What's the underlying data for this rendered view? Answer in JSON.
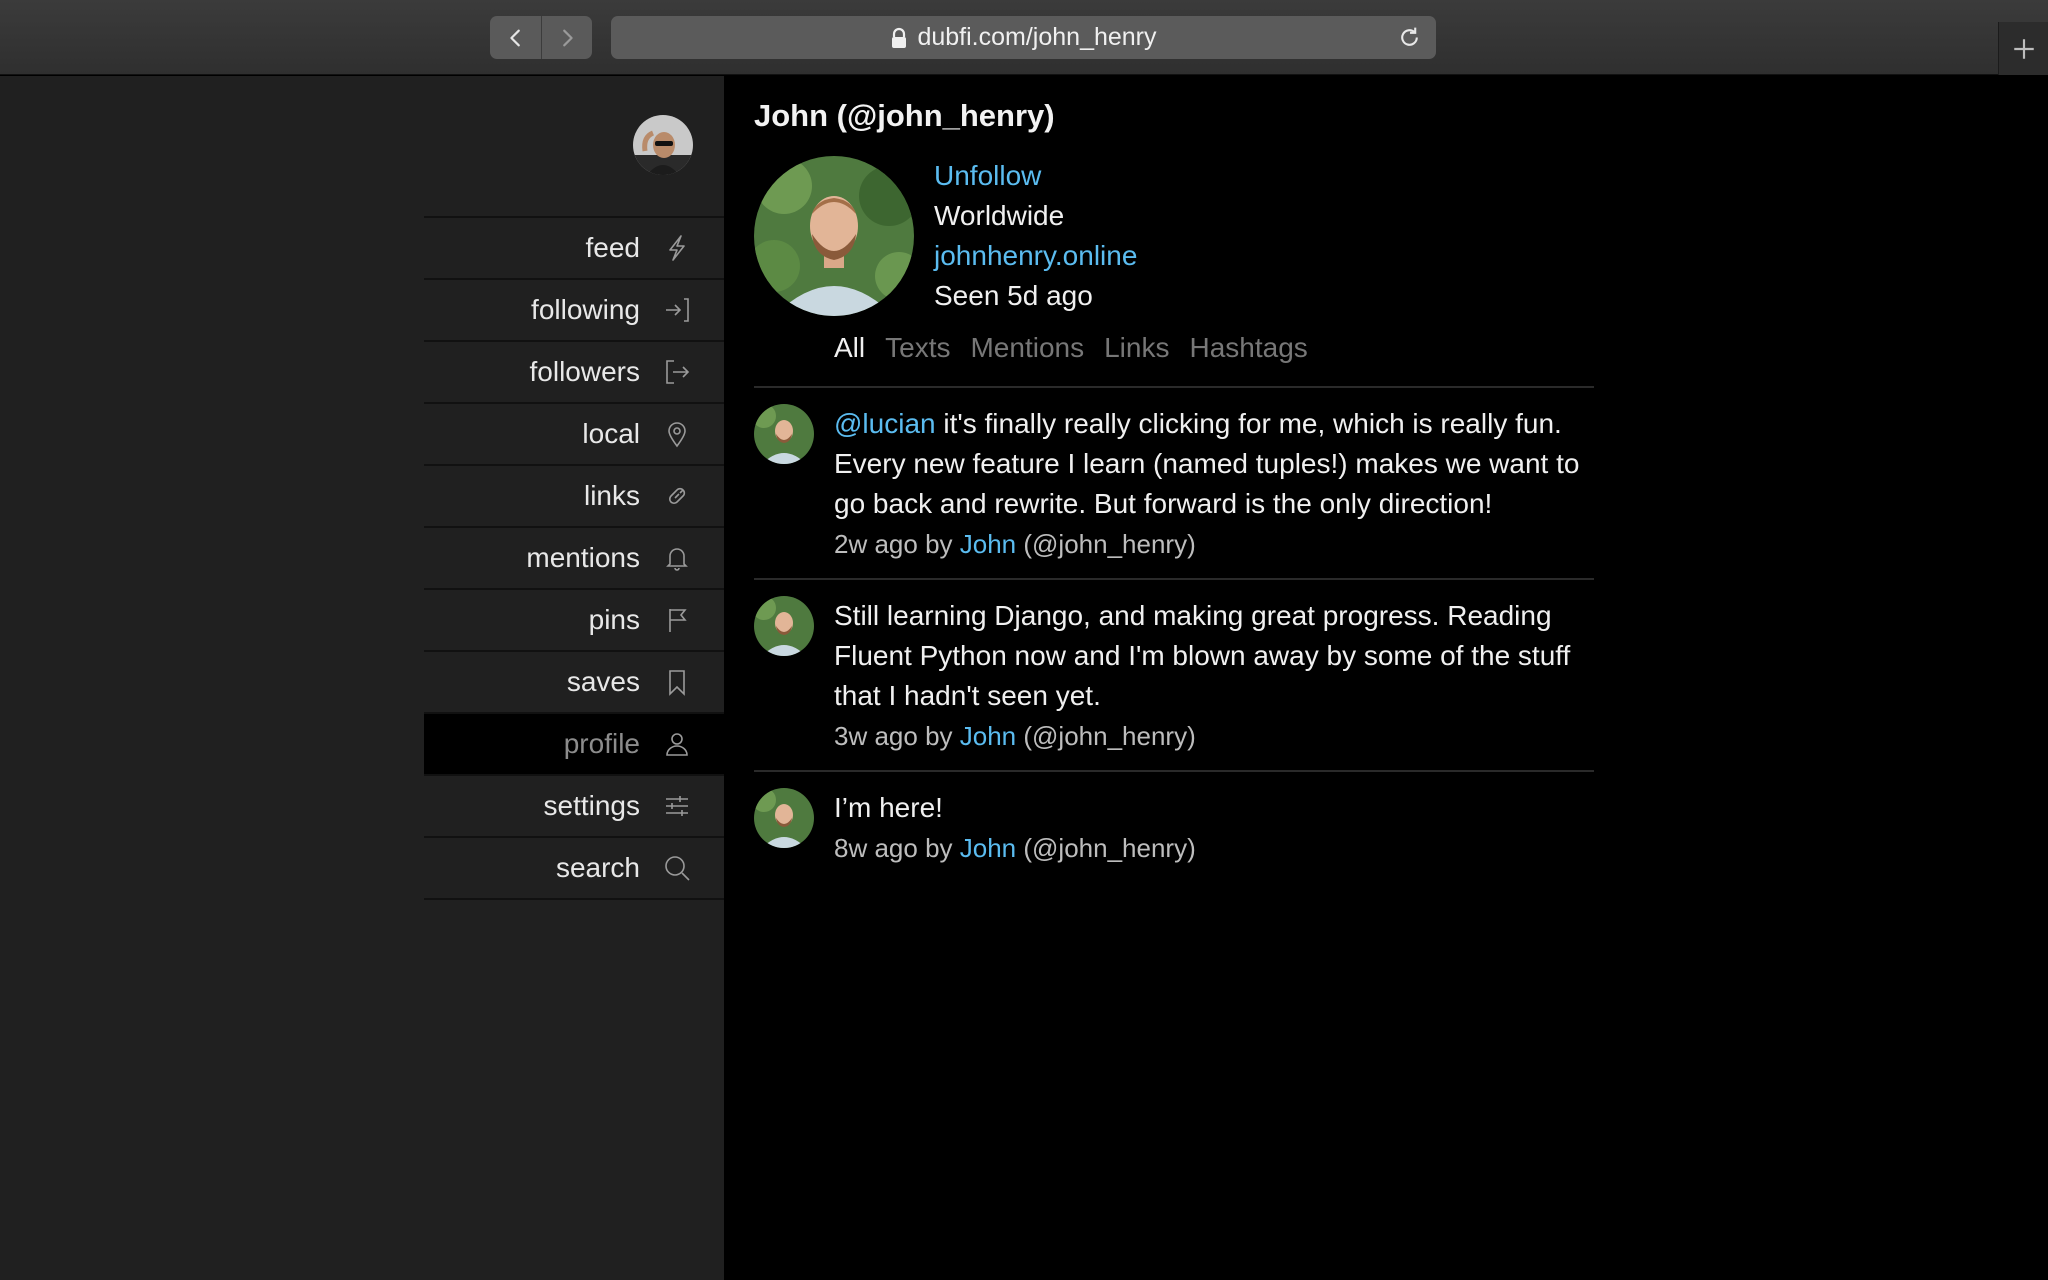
{
  "browser": {
    "url": "dubfi.com/john_henry",
    "icons": {
      "back": "chevron-left-icon",
      "forward": "chevron-right-icon",
      "lock": "lock-icon",
      "reload": "reload-icon",
      "new_tab": "plus-icon"
    }
  },
  "sidebar": {
    "items": [
      {
        "label": "feed",
        "icon": "bolt-icon"
      },
      {
        "label": "following",
        "icon": "sign-in-icon"
      },
      {
        "label": "followers",
        "icon": "sign-out-icon"
      },
      {
        "label": "local",
        "icon": "map-pin-icon"
      },
      {
        "label": "links",
        "icon": "link-icon"
      },
      {
        "label": "mentions",
        "icon": "bell-icon"
      },
      {
        "label": "pins",
        "icon": "flag-icon"
      },
      {
        "label": "saves",
        "icon": "bookmark-icon"
      },
      {
        "label": "profile",
        "icon": "user-icon",
        "active": true
      },
      {
        "label": "settings",
        "icon": "sliders-icon"
      },
      {
        "label": "search",
        "icon": "search-icon"
      }
    ]
  },
  "profile": {
    "title": "John (@john_henry)",
    "follow_action": "Unfollow",
    "location": "Worldwide",
    "website": "johnhenry.online",
    "last_seen": "Seen 5d ago"
  },
  "tabs": [
    {
      "label": "All",
      "active": true
    },
    {
      "label": "Texts"
    },
    {
      "label": "Mentions"
    },
    {
      "label": "Links"
    },
    {
      "label": "Hashtags"
    }
  ],
  "posts": [
    {
      "mention": "@lucian",
      "text": " it's finally really clicking for me, which is really fun. Every new feature I learn (named tuples!) makes we want to go back and rewrite. But forward is the only direction!",
      "time": "2w ago by ",
      "author": "John",
      "handle": " (@john_henry)"
    },
    {
      "mention": "",
      "text": "Still learning Django, and making great progress. Reading Fluent Python now and I'm blown away by some of the stuff that I hadn't seen yet.",
      "time": "3w ago by ",
      "author": "John",
      "handle": " (@john_henry)"
    },
    {
      "mention": "",
      "text": "I’m here!",
      "time": "8w ago by ",
      "author": "John",
      "handle": " (@john_henry)"
    }
  ],
  "colors": {
    "link": "#5bbcf0",
    "sidebar_bg": "#202020",
    "main_bg": "#000000"
  }
}
